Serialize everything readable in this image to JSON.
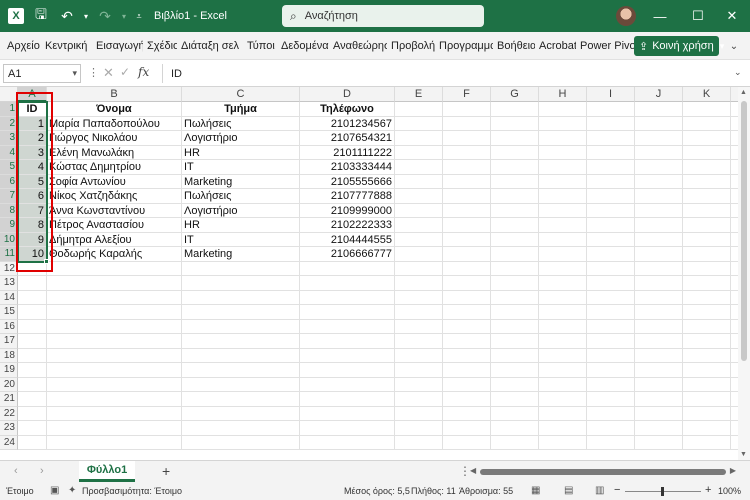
{
  "titlebar": {
    "doc_title": "Βιβλίο1 - Excel",
    "search_placeholder": "Αναζήτηση",
    "minimize": "—",
    "maximize": "☐",
    "close": "✕"
  },
  "ribbon": {
    "tabs": [
      "Αρχείο",
      "Κεντρική",
      "Εισαγωγή",
      "Σχέδιο",
      "Διάταξη σελ",
      "Τύποι",
      "Δεδομένα",
      "Αναθεώρησ",
      "Προβολή",
      "Προγραμμα",
      "Βοήθεια",
      "Acrobat",
      "Power Pivot"
    ],
    "share_label": "Κοινή χρήση"
  },
  "formula_bar": {
    "name_box": "A1",
    "fx": "fx",
    "content": "ID"
  },
  "columns": [
    "A",
    "B",
    "C",
    "D",
    "E",
    "F",
    "G",
    "H",
    "I",
    "J",
    "K",
    "L"
  ],
  "rows": [
    "1",
    "2",
    "3",
    "4",
    "5",
    "6",
    "7",
    "8",
    "9",
    "10",
    "11",
    "12",
    "13",
    "14",
    "15",
    "16",
    "17",
    "18",
    "19",
    "20",
    "21",
    "22",
    "23",
    "24"
  ],
  "table": {
    "headers": [
      "ID",
      "Όνομα",
      "Τμήμα",
      "Τηλέφωνο"
    ],
    "records": [
      [
        "1",
        "Μαρία Παπαδοπούλου",
        "Πωλήσεις",
        "2101234567"
      ],
      [
        "2",
        "Γιώργος Νικολάου",
        "Λογιστήριο",
        "2107654321"
      ],
      [
        "3",
        "Ελένη Μανωλάκη",
        "HR",
        "2101111222"
      ],
      [
        "4",
        "Κώστας Δημητρίου",
        "IT",
        "2103333444"
      ],
      [
        "5",
        "Σοφία Αντωνίου",
        "Marketing",
        "2105555666"
      ],
      [
        "6",
        "Νίκος Χατζηδάκης",
        "Πωλήσεις",
        "2107777888"
      ],
      [
        "7",
        "Άννα Κωνσταντίνου",
        "Λογιστήριο",
        "2109999000"
      ],
      [
        "8",
        "Πέτρος Αναστασίου",
        "HR",
        "2102222333"
      ],
      [
        "9",
        "Δήμητρα Αλεξίου",
        "IT",
        "2104444555"
      ],
      [
        "10",
        "Θοδωρής Καραλής",
        "Marketing",
        "2106666777"
      ]
    ]
  },
  "sheet_tabs": {
    "active": "Φύλλο1",
    "add": "+"
  },
  "statusbar": {
    "mode": "Έτοιμο",
    "accessibility": "Προσβασιμότητα: Έτοιμο",
    "average": "Μέσος όρος: 5,5",
    "count": "Πλήθος: 11",
    "sum": "Άθροισμα: 55",
    "zoom": "100%",
    "zoom_minus": "−",
    "zoom_plus": "+"
  },
  "colors": {
    "excel_green": "#1e7145",
    "highlight_red": "#e00000",
    "selection_tint": "#cfd6d1"
  },
  "zoom_level_percent": 100
}
